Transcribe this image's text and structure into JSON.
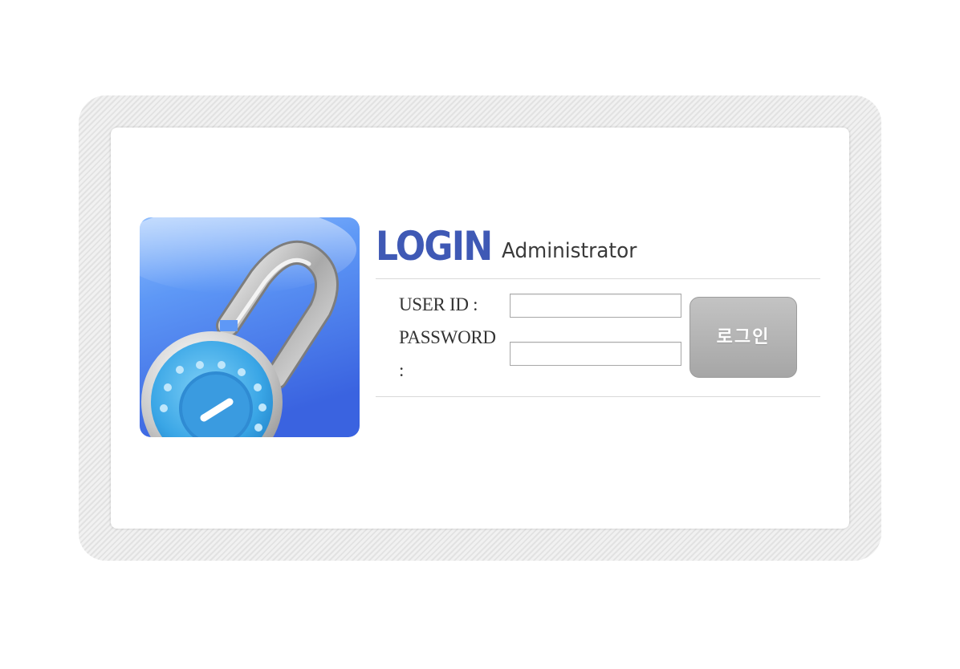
{
  "header": {
    "title": "LOGIN",
    "subtitle": "Administrator"
  },
  "form": {
    "user_id_label": "USER ID :",
    "password_label": "PASSWORD",
    "password_colon": ":",
    "user_id_value": "",
    "password_value": ""
  },
  "button": {
    "login_label": "로그인"
  },
  "icons": {
    "lock": "padlock-icon"
  },
  "colors": {
    "accent": "#3f59b5",
    "button": "#b3b3b3",
    "tile_blue": "#4d82f0"
  }
}
